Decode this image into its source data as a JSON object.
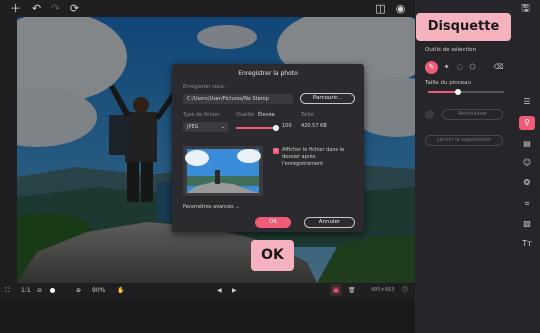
{
  "toolbar": {
    "icons": [
      "add-icon",
      "undo-icon",
      "redo-icon",
      "refresh-icon",
      "compare-icon",
      "eye-icon",
      "save-disk-icon"
    ]
  },
  "callouts": {
    "save": "Disquette",
    "ok": "OK"
  },
  "right_panel": {
    "selection_tool_label": "Outils de sélection",
    "brush_size_label": "Taille du pinceau",
    "brush_size_level": 0.4,
    "reinit_label": "Réinitialiser",
    "remove_watermark_label": "Lancer la suppression"
  },
  "dialog": {
    "title": "Enregistrer la photo",
    "save_to_label": "Enregistrer sous :",
    "path": "C:/Users/User/Pictures/No Stamp",
    "browse_label": "Parcourir...",
    "file_type_label": "Type de fichier",
    "file_type_value": "JPEG",
    "quality_label": "Qualité",
    "quality_value_label": "Élevée",
    "quality_value": "100",
    "size_label": "Taille",
    "size_value": "420.57 KB",
    "checkbox_label": "Afficher le fichier dans le dossier après l'enregistrement",
    "advanced_label": "Paramètres avancés",
    "ok_label": "OK",
    "cancel_label": "Annuler"
  },
  "bottombar": {
    "ratio": "1:1",
    "zoom": "90%",
    "dimensions": "995×663"
  },
  "colors": {
    "accent": "#f05b78",
    "callout": "#f6b3bf",
    "panel": "#26262a",
    "background": "#1f1f22"
  }
}
